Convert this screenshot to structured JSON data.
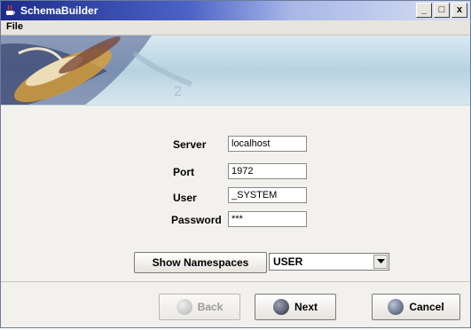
{
  "window": {
    "title": "SchemaBuilder",
    "controls": {
      "minimize": "_",
      "maximize": "□",
      "close": "x"
    }
  },
  "menu": {
    "file": "File"
  },
  "form": {
    "server_label": "Server",
    "server_value": "localhost",
    "port_label": "Port",
    "port_value": "1972",
    "user_label": "User",
    "user_value": "_SYSTEM",
    "password_label": "Password",
    "password_value": "***"
  },
  "namespace": {
    "button_label": "Show Namespaces",
    "selected": "USER"
  },
  "buttons": {
    "back": "Back",
    "next": "Next",
    "cancel": "Cancel"
  },
  "colors": {
    "titlebar_start": "#1d2c8a",
    "banner": "#b7d3e0",
    "panel": "#f3f1ed"
  }
}
